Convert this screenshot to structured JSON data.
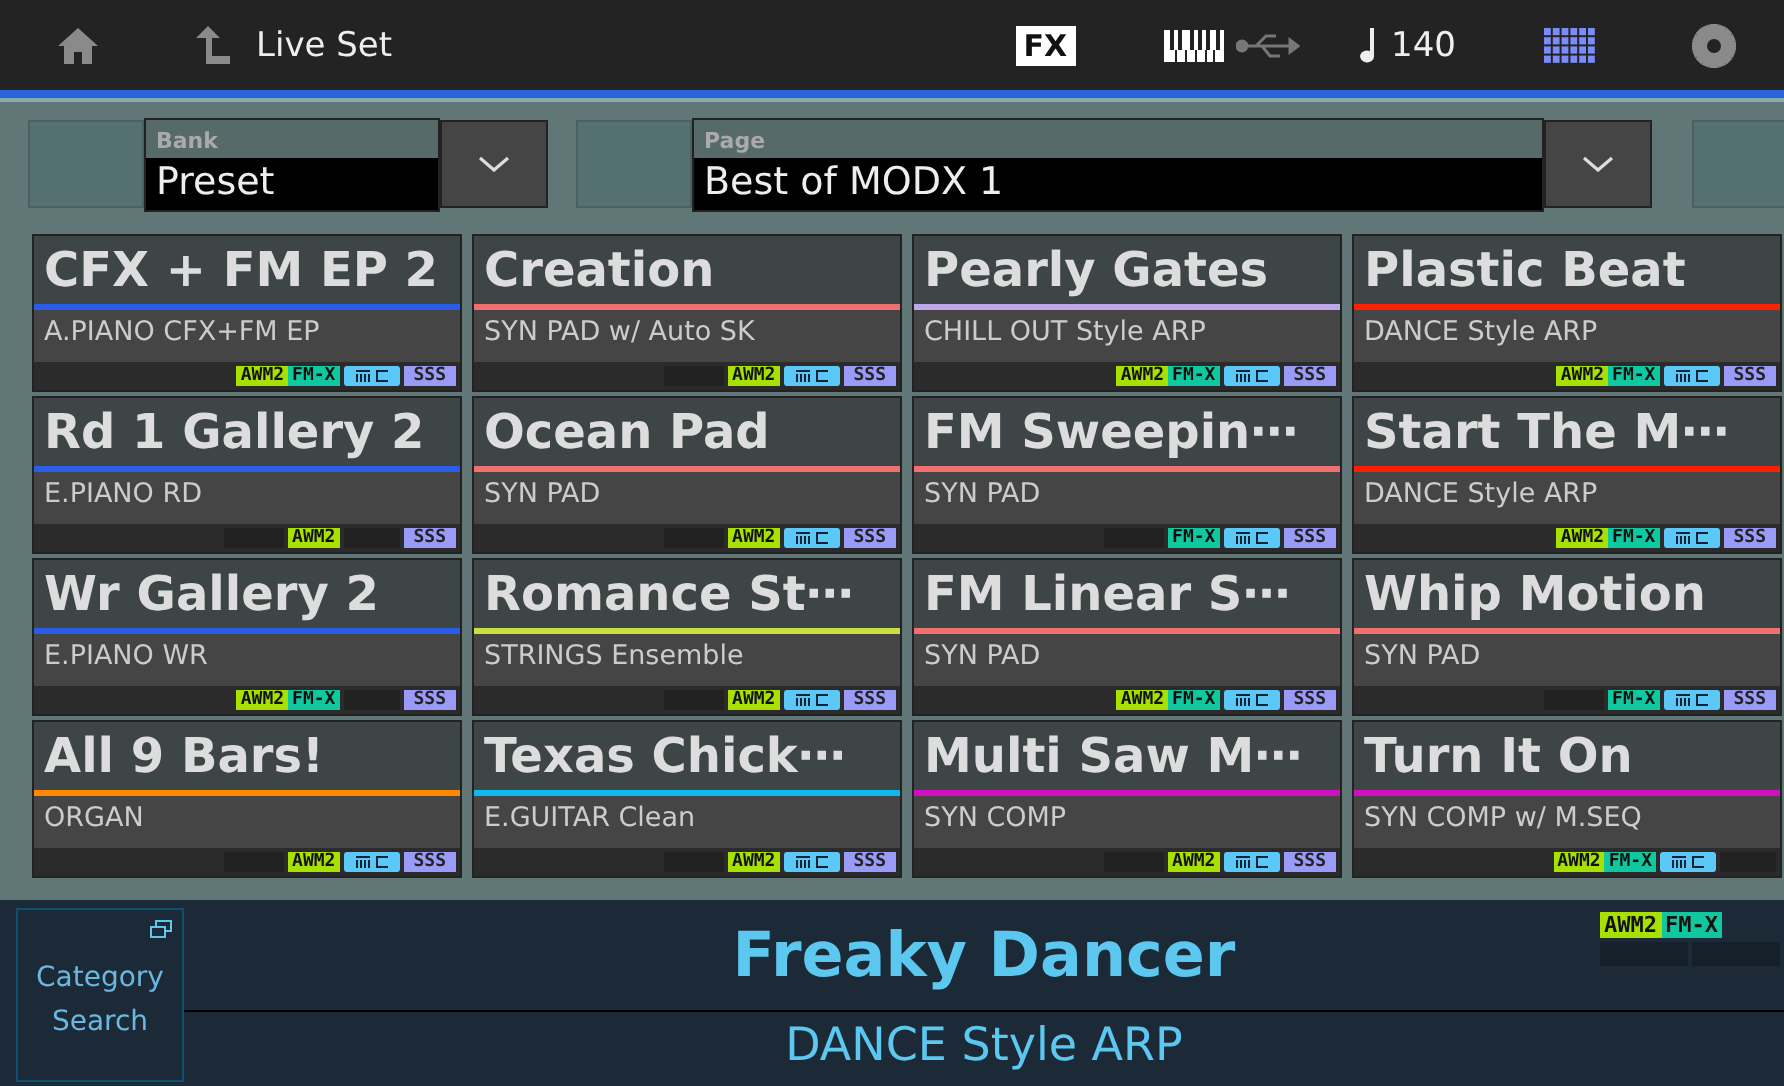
{
  "top_bar": {
    "title": "Live Set",
    "fx": "FX",
    "tempo": "140"
  },
  "bank": {
    "label": "Bank",
    "value": "Preset"
  },
  "page": {
    "label": "Page",
    "value": "Best of MODX 1"
  },
  "performances": [
    {
      "name": "CFX + FM EP 2",
      "category": "A.PIANO CFX+FM EP",
      "color": "#2a5de8",
      "engine": [
        {
          "kind": "awm2",
          "label": "AWM2"
        },
        {
          "kind": "fmx",
          "label": "FM-X"
        }
      ],
      "mc": true,
      "sss": "SSS"
    },
    {
      "name": "Creation",
      "category": "SYN PAD w/ Auto SK",
      "color": "#f07070",
      "engine": [
        {
          "kind": "awm2",
          "label": "AWM2"
        }
      ],
      "mc": true,
      "sss": "SSS"
    },
    {
      "name": "Pearly Gates",
      "category": "CHILL OUT Style ARP",
      "color": "#c0a8e8",
      "engine": [
        {
          "kind": "awm2",
          "label": "AWM2"
        },
        {
          "kind": "fmx",
          "label": "FM-X"
        }
      ],
      "mc": true,
      "sss": "SSS"
    },
    {
      "name": "Plastic Beat",
      "category": "DANCE Style ARP",
      "color": "#ff2000",
      "engine": [
        {
          "kind": "awm2",
          "label": "AWM2"
        },
        {
          "kind": "fmx",
          "label": "FM-X"
        }
      ],
      "mc": true,
      "sss": "SSS"
    },
    {
      "name": "Rd 1 Gallery 2",
      "category": "E.PIANO RD",
      "color": "#2a5de8",
      "engine": [
        {
          "kind": "awm2",
          "label": "AWM2"
        }
      ],
      "mc": false,
      "sss": "SSS"
    },
    {
      "name": "Ocean Pad",
      "category": "SYN PAD",
      "color": "#f07070",
      "engine": [
        {
          "kind": "awm2",
          "label": "AWM2"
        }
      ],
      "mc": true,
      "sss": "SSS"
    },
    {
      "name": "FM Sweepin⋯",
      "category": "SYN PAD",
      "color": "#f07070",
      "engine": [
        {
          "kind": "fmx",
          "label": "FM-X"
        }
      ],
      "mc": true,
      "sss": "SSS"
    },
    {
      "name": "Start The M⋯",
      "category": "DANCE Style ARP",
      "color": "#ff2000",
      "engine": [
        {
          "kind": "awm2",
          "label": "AWM2"
        },
        {
          "kind": "fmx",
          "label": "FM-X"
        }
      ],
      "mc": true,
      "sss": "SSS"
    },
    {
      "name": "Wr Gallery 2",
      "category": "E.PIANO WR",
      "color": "#2a5de8",
      "engine": [
        {
          "kind": "awm2",
          "label": "AWM2"
        },
        {
          "kind": "fmx",
          "label": "FM-X"
        }
      ],
      "mc": false,
      "sss": "SSS"
    },
    {
      "name": "Romance St⋯",
      "category": "STRINGS Ensemble",
      "color": "#c8e040",
      "engine": [
        {
          "kind": "awm2",
          "label": "AWM2"
        }
      ],
      "mc": true,
      "sss": "SSS"
    },
    {
      "name": "FM Linear S⋯",
      "category": "SYN PAD",
      "color": "#f07070",
      "engine": [
        {
          "kind": "awm2",
          "label": "AWM2"
        },
        {
          "kind": "fmx",
          "label": "FM-X"
        }
      ],
      "mc": true,
      "sss": "SSS"
    },
    {
      "name": "Whip Motion",
      "category": "SYN PAD",
      "color": "#f07070",
      "engine": [
        {
          "kind": "fmx",
          "label": "FM-X"
        }
      ],
      "mc": true,
      "sss": "SSS"
    },
    {
      "name": "All 9 Bars!",
      "category": "ORGAN",
      "color": "#ff8800",
      "engine": [
        {
          "kind": "awm2",
          "label": "AWM2"
        }
      ],
      "mc": true,
      "sss": "SSS"
    },
    {
      "name": "Texas Chick⋯",
      "category": "E.GUITAR Clean",
      "color": "#10b8f0",
      "engine": [
        {
          "kind": "awm2",
          "label": "AWM2"
        }
      ],
      "mc": true,
      "sss": "SSS"
    },
    {
      "name": "Multi Saw M⋯",
      "category": "SYN COMP",
      "color": "#d010c0",
      "engine": [
        {
          "kind": "awm2",
          "label": "AWM2"
        }
      ],
      "mc": true,
      "sss": "SSS"
    },
    {
      "name": "Turn It On",
      "category": "SYN COMP w/ M.SEQ",
      "color": "#d010c0",
      "engine": [
        {
          "kind": "awm2",
          "label": "AWM2"
        },
        {
          "kind": "fmx",
          "label": "FM-X"
        }
      ],
      "mc": true
    }
  ],
  "current": {
    "category_button": "Category Search",
    "name": "Freaky Dancer",
    "category": "DANCE Style ARP",
    "engine": [
      {
        "kind": "awm2",
        "label": "AWM2"
      },
      {
        "kind": "fmx",
        "label": "FM-X"
      }
    ]
  }
}
